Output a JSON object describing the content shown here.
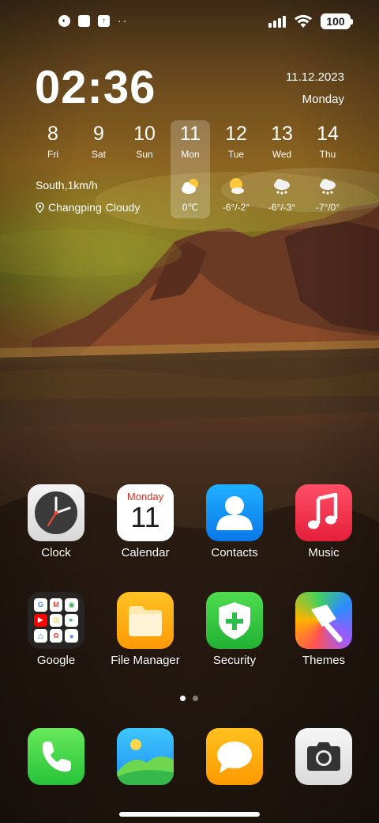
{
  "status_bar": {
    "battery": "100",
    "notification_icons": [
      "app-notification-icon",
      "square-notification-icon",
      "upload-notification-icon"
    ],
    "overflow": "··"
  },
  "clock_widget": {
    "time": "02:36",
    "date": "11.12.2023",
    "weekday": "Monday",
    "wind": "South,1km/h",
    "location": "Changping",
    "condition": "Cloudy",
    "forecast": [
      {
        "num": "8",
        "name": "Fri"
      },
      {
        "num": "9",
        "name": "Sat"
      },
      {
        "num": "10",
        "name": "Sun"
      },
      {
        "num": "11",
        "name": "Mon",
        "temp": "0℃",
        "icon": "partly-cloudy-icon"
      },
      {
        "num": "12",
        "name": "Tue",
        "temp": "-6°/-2°",
        "icon": "partly-cloudy-icon"
      },
      {
        "num": "13",
        "name": "Wed",
        "temp": "-6°/-3°",
        "icon": "snow-cloud-icon"
      },
      {
        "num": "14",
        "name": "Thu",
        "temp": "-7°/0°",
        "icon": "snow-cloud-icon"
      }
    ]
  },
  "apps": [
    {
      "label": "Clock",
      "icon": "clock-icon"
    },
    {
      "label": "Calendar",
      "icon": "calendar-icon",
      "tile_month_day": "Monday",
      "tile_date": "11"
    },
    {
      "label": "Contacts",
      "icon": "contacts-icon"
    },
    {
      "label": "Music",
      "icon": "music-note-icon"
    },
    {
      "label": "Google",
      "icon": "google-folder-icon"
    },
    {
      "label": "File Manager",
      "icon": "folder-icon"
    },
    {
      "label": "Security",
      "icon": "shield-icon"
    },
    {
      "label": "Themes",
      "icon": "paintbrush-icon"
    }
  ],
  "dock": [
    {
      "icon": "phone-icon"
    },
    {
      "icon": "gallery-icon"
    },
    {
      "icon": "messages-icon"
    },
    {
      "icon": "camera-icon"
    }
  ],
  "pages": {
    "count": 2,
    "active": 1
  },
  "colors": {
    "calendar_accent": "#e02d24",
    "contacts": "#0a78e8",
    "music": "#e5203c",
    "security": "#21b233",
    "file_manager": "#ff9a05"
  }
}
